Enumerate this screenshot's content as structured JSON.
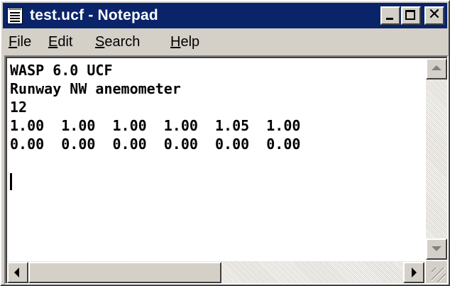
{
  "window": {
    "title": "test.ucf - Notepad",
    "icons": {
      "app": "notepad-icon",
      "minimize": "minimize-icon",
      "maximize": "maximize-icon",
      "close": "close-icon"
    },
    "close_glyph": "✕"
  },
  "menubar": {
    "items": [
      {
        "mnemonic": "F",
        "rest": "ile"
      },
      {
        "mnemonic": "E",
        "rest": "dit"
      },
      {
        "mnemonic": "S",
        "rest": "earch"
      },
      {
        "mnemonic": "H",
        "rest": "elp"
      }
    ]
  },
  "document": {
    "lines": [
      "WASP 6.0 UCF",
      "Runway NW anemometer",
      "12",
      "1.00  1.00  1.00  1.00  1.05  1.00",
      "0.00  0.00  0.00  0.00  0.00  0.00"
    ]
  },
  "scrollbars": {
    "icons": {
      "up": "scroll-up-arrow-icon",
      "down": "scroll-down-arrow-icon",
      "left": "scroll-left-arrow-icon",
      "right": "scroll-right-arrow-icon",
      "grip": "resize-grip-icon"
    }
  },
  "colors": {
    "titlebar": "#0a246a",
    "face": "#d4d0c8",
    "text": "#000000",
    "editor_bg": "#ffffff"
  }
}
